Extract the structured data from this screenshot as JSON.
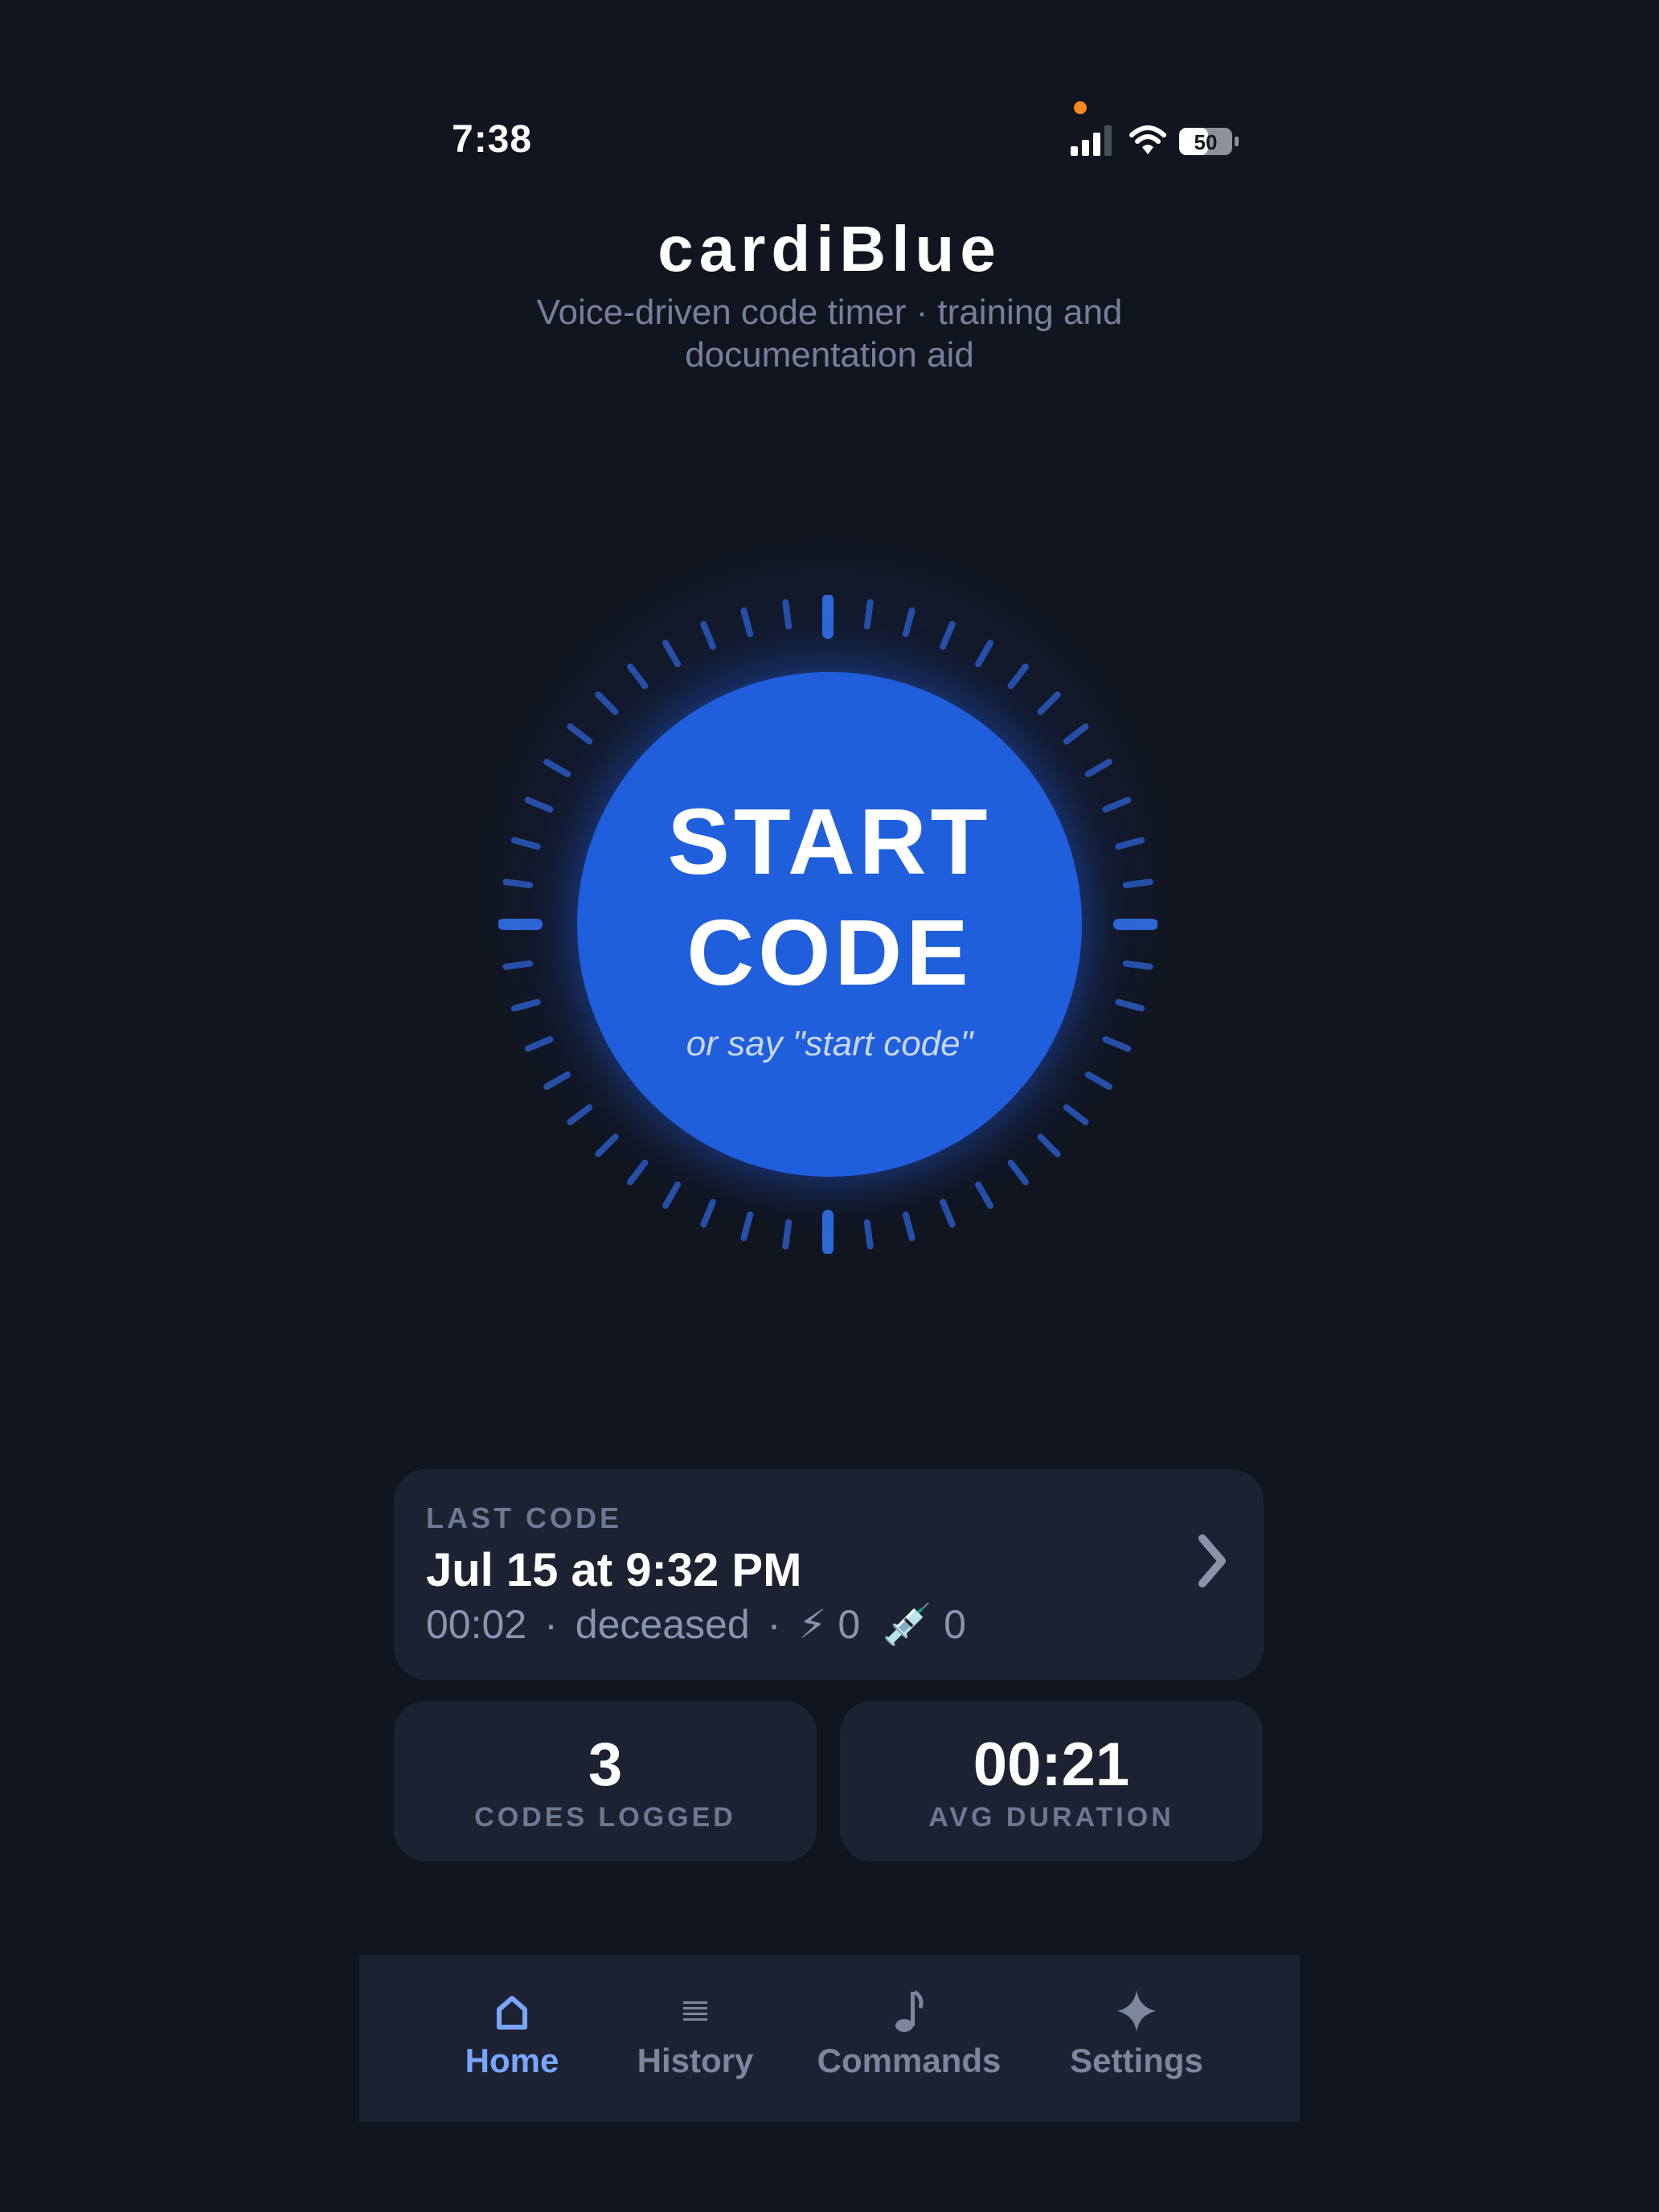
{
  "status_bar": {
    "time": "7:38",
    "battery": "50",
    "icons": [
      "mic-dot",
      "signal-icon",
      "wifi-icon",
      "battery-icon"
    ]
  },
  "header": {
    "title": "cardiBlue",
    "subtitle": "Voice-driven code timer · training and documentation aid"
  },
  "start_button": {
    "label_line1": "START",
    "label_line2": "CODE",
    "hint": "or say \"start code\""
  },
  "last_code": {
    "label": "LAST CODE",
    "date": "Jul 15 at 9:32 PM",
    "duration": "00:02",
    "outcome": "deceased",
    "separator": "·",
    "shock_icon": "⚡",
    "shocks": "0",
    "med_icon": "💉",
    "meds": "0"
  },
  "stats": {
    "codes_logged": {
      "value": "3",
      "label": "CODES LOGGED"
    },
    "avg_duration": {
      "value": "00:21",
      "label": "AVG DURATION"
    }
  },
  "tabs": [
    {
      "label": "Home",
      "icon": "home-icon",
      "active": true
    },
    {
      "label": "History",
      "icon": "list-icon",
      "active": false
    },
    {
      "label": "Commands",
      "icon": "music-note-icon",
      "active": false
    },
    {
      "label": "Settings",
      "icon": "sparkle-icon",
      "active": false
    }
  ],
  "colors": {
    "background": "#111520",
    "card": "#1d2232",
    "accent": "#1f5fdc",
    "active_tab": "#78a6ff",
    "muted_text": "#76809a",
    "recording_dot": "#f5891f"
  }
}
